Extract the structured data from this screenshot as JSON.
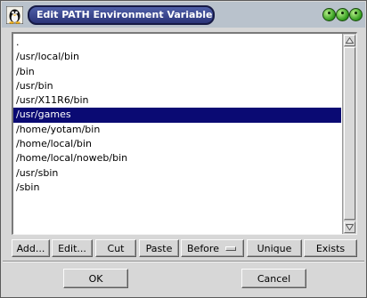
{
  "window": {
    "title": "Edit  PATH  Environment Variable"
  },
  "path_list": {
    "items": [
      ".",
      "/usr/local/bin",
      "/bin",
      "/usr/bin",
      "/usr/X11R6/bin",
      "/usr/games",
      "/home/yotam/bin",
      "/home/local/bin",
      "/home/local/noweb/bin",
      "/usr/sbin",
      "/sbin"
    ],
    "selected": "/usr/games"
  },
  "toolbar": {
    "add_label": "Add...",
    "edit_label": "Edit...",
    "cut_label": "Cut",
    "paste_label": "Paste",
    "position_option": "Before",
    "unique_label": "Unique",
    "exists_label": "Exists"
  },
  "dialog": {
    "ok_label": "OK",
    "cancel_label": "Cancel"
  },
  "colors": {
    "selection": "#0a0a73",
    "title_tab": "#2b3478",
    "window_buttons": "#2f9a1b"
  },
  "icons": [
    "tux-penguin-icon",
    "window-button-icon",
    "scroll-up-icon",
    "scroll-down-icon"
  ]
}
